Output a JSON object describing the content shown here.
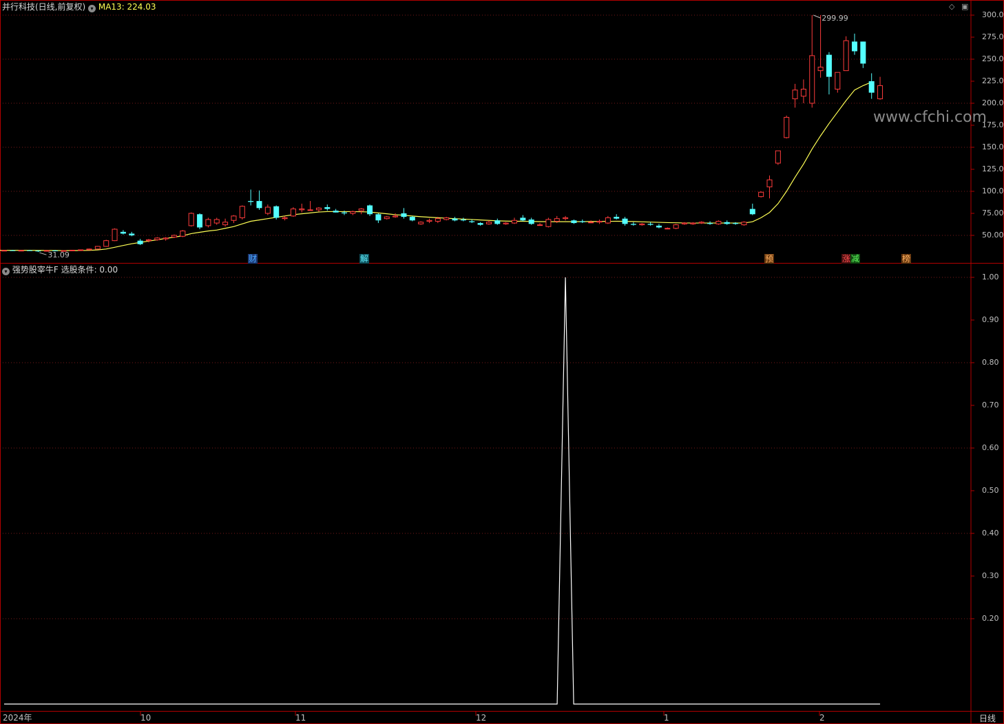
{
  "header": {
    "stock_title": "并行科技(日线,前复权)",
    "ma_label": "MA13: 224.03",
    "indicator_title": "强势股宰牛F",
    "indicator_value": "选股条件: 0.00"
  },
  "price_axis": {
    "ticks": [
      300,
      275,
      250,
      225,
      200,
      175,
      150,
      125,
      100,
      75,
      50
    ],
    "labels": [
      "300.00",
      "275.00",
      "250.00",
      "225.00",
      "200.00",
      "175.00",
      "150.00",
      "125.00",
      "100.00",
      "75.00",
      "50.00"
    ]
  },
  "indicator_axis": {
    "ticks": [
      1.0,
      0.9,
      0.8,
      0.7,
      0.6,
      0.5,
      0.4,
      0.3,
      0.2
    ],
    "labels": [
      "1.00",
      "0.90",
      "0.80",
      "0.70",
      "0.60",
      "0.50",
      "0.40",
      "0.30",
      "0.20"
    ]
  },
  "markers": {
    "high_label": "299.99",
    "low_label": "31.09"
  },
  "events": [
    {
      "text": "财",
      "color": "#4aa8ff",
      "bg": "#1e3c78"
    },
    {
      "text": "解",
      "color": "#5ff0ff",
      "bg": "#0f4f5a"
    },
    {
      "text": "预",
      "color": "#ffb060",
      "bg": "#6a3a10"
    },
    {
      "text": "涨",
      "color": "#ff5050",
      "bg": "#4a1010"
    },
    {
      "text": "减",
      "color": "#60ff60",
      "bg": "#104a10"
    },
    {
      "text": "榜",
      "color": "#ffb060",
      "bg": "#6a3a10"
    }
  ],
  "x_labels": [
    "2024年",
    "10",
    "11",
    "12",
    "1",
    "2"
  ],
  "period_label": "日线",
  "watermark": "www.cfchi.com",
  "colors": {
    "up": "#ff3c3c",
    "down": "#54ffff",
    "ma": "#ffff55",
    "grid": "#7a1a1a",
    "frame": "#b40000",
    "signal": "#ffffff"
  },
  "chart_data": {
    "type": "candlestick",
    "series_name": "MA13",
    "candles_ohlc": [
      [
        33,
        33.5,
        32.5,
        33
      ],
      [
        33,
        33.6,
        32.4,
        32.8
      ],
      [
        32.8,
        33.4,
        32.2,
        33
      ],
      [
        33,
        33.5,
        32.5,
        32.6
      ],
      [
        32.6,
        33.2,
        31.09,
        32.5
      ],
      [
        32.5,
        33,
        32,
        32.8
      ],
      [
        32.8,
        33.4,
        32.3,
        32.4
      ],
      [
        32.4,
        33,
        32,
        32.7
      ],
      [
        32.7,
        33.5,
        32.3,
        33.2
      ],
      [
        33.2,
        34,
        32.8,
        33.6
      ],
      [
        33.6,
        35,
        33.2,
        34.5
      ],
      [
        34.5,
        38,
        34,
        37.5
      ],
      [
        37.5,
        45,
        37,
        44
      ],
      [
        44,
        58,
        43.5,
        57
      ],
      [
        54,
        56,
        51,
        52
      ],
      [
        52,
        54,
        49,
        50
      ],
      [
        44,
        46,
        39,
        40
      ],
      [
        44,
        46,
        42,
        45
      ],
      [
        45,
        48,
        44,
        47
      ],
      [
        46,
        48,
        44,
        47
      ],
      [
        48,
        51,
        47,
        50
      ],
      [
        49,
        56,
        48,
        55
      ],
      [
        61,
        76,
        60,
        75
      ],
      [
        74,
        75,
        57,
        59
      ],
      [
        61,
        70,
        59,
        68
      ],
      [
        64,
        70,
        62,
        68
      ],
      [
        62,
        69,
        60,
        65
      ],
      [
        67,
        73,
        64,
        72
      ],
      [
        70,
        84,
        68,
        83
      ],
      [
        89,
        102,
        84,
        88
      ],
      [
        89,
        101,
        79,
        81
      ],
      [
        75,
        85,
        73,
        82
      ],
      [
        83,
        84,
        68,
        70
      ],
      [
        69,
        72,
        67,
        70
      ],
      [
        72,
        82,
        71,
        80
      ],
      [
        79,
        86,
        76,
        80
      ],
      [
        79,
        89,
        78,
        79
      ],
      [
        79,
        82,
        77,
        81
      ],
      [
        82,
        85,
        78,
        80
      ],
      [
        78,
        80,
        76,
        76
      ],
      [
        76,
        78,
        73,
        75
      ],
      [
        75,
        78,
        73,
        77
      ],
      [
        78,
        81,
        74,
        80
      ],
      [
        84,
        85,
        72,
        74
      ],
      [
        74,
        75,
        64,
        67
      ],
      [
        69,
        72,
        68,
        71
      ],
      [
        71,
        75,
        70,
        72
      ],
      [
        75,
        81,
        69,
        71
      ],
      [
        71,
        72,
        66,
        67
      ],
      [
        63,
        66,
        62,
        65
      ],
      [
        66,
        69,
        64,
        67
      ],
      [
        66,
        71,
        64,
        69
      ],
      [
        68,
        71,
        67,
        70
      ],
      [
        69,
        71,
        66,
        67
      ],
      [
        68,
        70,
        66,
        67
      ],
      [
        66,
        68,
        64,
        65
      ],
      [
        64,
        65,
        61,
        62
      ],
      [
        63,
        67,
        62,
        65
      ],
      [
        67,
        69,
        62,
        63
      ],
      [
        63,
        65,
        62,
        64
      ],
      [
        64,
        70,
        63,
        67
      ],
      [
        70,
        73,
        66,
        67
      ],
      [
        68,
        70,
        62,
        63
      ],
      [
        62,
        64,
        61,
        62
      ],
      [
        60,
        70,
        59,
        68
      ],
      [
        66,
        72,
        64,
        69
      ],
      [
        69,
        72,
        67,
        70
      ],
      [
        67,
        68,
        63,
        64
      ],
      [
        66,
        68,
        64,
        65
      ],
      [
        65,
        67,
        64,
        65
      ],
      [
        65,
        68,
        63,
        66
      ],
      [
        64,
        72,
        63,
        70
      ],
      [
        71,
        74,
        68,
        69
      ],
      [
        69,
        71,
        61,
        63
      ],
      [
        63,
        65,
        61,
        62
      ],
      [
        62,
        64,
        61,
        63
      ],
      [
        63,
        65,
        61,
        62
      ],
      [
        61,
        63,
        58,
        59
      ],
      [
        58,
        59,
        57,
        58
      ],
      [
        58,
        63,
        57,
        62
      ],
      [
        63,
        65,
        62,
        64
      ],
      [
        63,
        65,
        62,
        64
      ],
      [
        64,
        66,
        63,
        65
      ],
      [
        64,
        66,
        62,
        63
      ],
      [
        63,
        67,
        62,
        66
      ],
      [
        65,
        67,
        62,
        63
      ],
      [
        64,
        65,
        62,
        63
      ],
      [
        62,
        66,
        61,
        65
      ],
      [
        80,
        86,
        73,
        74
      ],
      [
        94,
        100,
        93,
        99
      ],
      [
        105,
        118,
        92,
        113
      ],
      [
        132,
        146,
        130,
        146
      ],
      [
        161,
        186,
        160,
        184
      ],
      [
        205,
        222,
        195,
        215
      ],
      [
        208,
        227,
        200,
        216
      ],
      [
        200,
        300,
        195,
        254
      ],
      [
        237,
        299.99,
        229,
        241
      ],
      [
        255,
        258,
        210,
        230
      ],
      [
        216,
        232,
        212,
        235
      ],
      [
        237,
        276,
        237,
        271
      ],
      [
        270,
        279,
        255,
        259
      ],
      [
        270,
        270,
        240,
        245
      ],
      [
        225,
        234,
        205,
        212
      ],
      [
        205,
        230,
        204,
        220
      ]
    ],
    "ma13": [
      33,
      33,
      33,
      33,
      32.9,
      32.9,
      32.8,
      32.7,
      32.7,
      32.8,
      33,
      33.5,
      34.5,
      36.5,
      38.5,
      40.5,
      42,
      43.5,
      45,
      46.5,
      48,
      49.5,
      52,
      53.5,
      55,
      56,
      58,
      60,
      63,
      66,
      67.5,
      69,
      70.5,
      72,
      73.5,
      74.5,
      75.5,
      76.5,
      77,
      77,
      77,
      77,
      76.8,
      76.5,
      75.5,
      74.5,
      73.5,
      72.8,
      72,
      71.2,
      70.6,
      70,
      69.5,
      69,
      68.5,
      68,
      67.5,
      67,
      66.5,
      66.2,
      66,
      66,
      65.8,
      65.6,
      65.5,
      65.5,
      65.5,
      65.5,
      65.6,
      65.7,
      65.8,
      65.9,
      66,
      65.9,
      65.7,
      65.4,
      65.1,
      64.8,
      64.5,
      64.3,
      64.1,
      64,
      64,
      64,
      64,
      64,
      64,
      64,
      65.5,
      70,
      76,
      86,
      100,
      116,
      131,
      148,
      163,
      177,
      190,
      203,
      215,
      220,
      224.03
    ],
    "signal_x_index": 66,
    "signal_values": {
      "peak": 1.0,
      "baseline": 0.0
    }
  }
}
